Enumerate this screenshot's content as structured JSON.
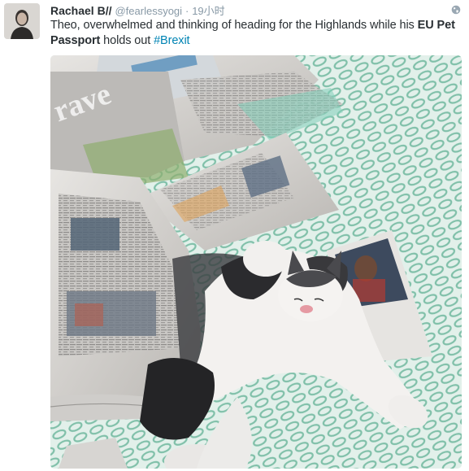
{
  "tweet": {
    "fullname": "Rachael B//",
    "username": "@fearlessyogi",
    "separator": "·",
    "timestamp": "19小时",
    "text_part1": "Theo, overwhelmed and thinking of heading for the Highlands while his ",
    "text_bold": "EU Pet Passport",
    "text_part2": " holds out ",
    "hashtag": "#Brexit",
    "avatar_icon": "user-avatar",
    "privacy_icon": "globe-icon",
    "photo_icon": "photo-cat-on-newspapers",
    "newspaper_heading": "rave"
  },
  "colors": {
    "name": "#292f33",
    "meta": "#8899a6",
    "link": "#0084b4",
    "text": "#292f33"
  }
}
